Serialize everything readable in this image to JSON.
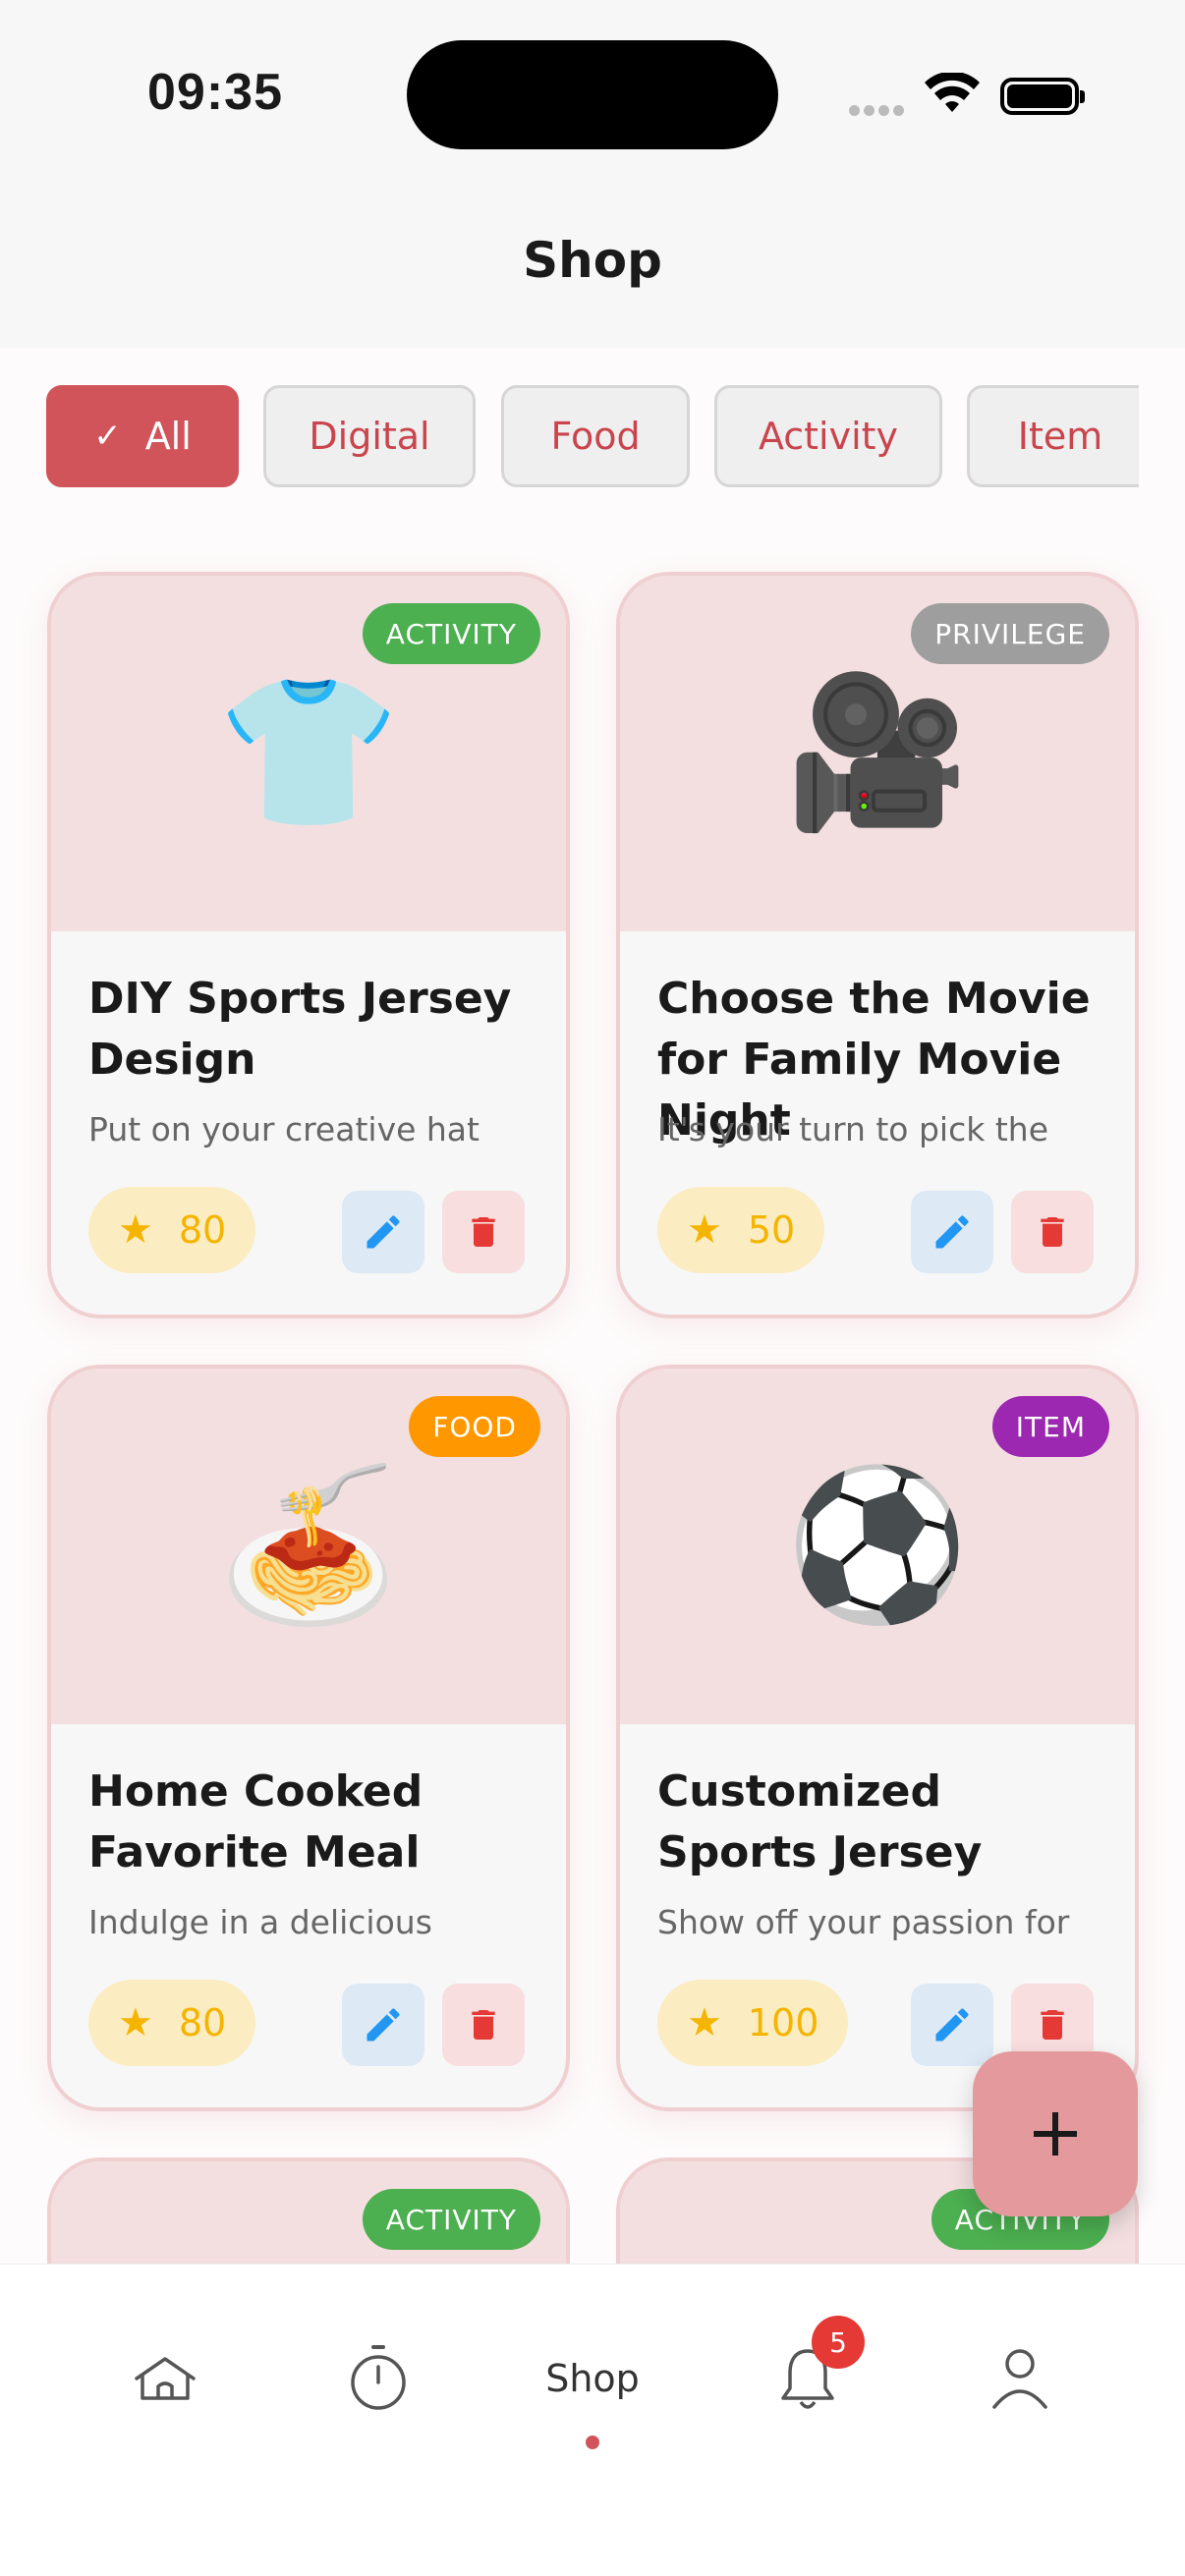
{
  "status_bar": {
    "time": "09:35"
  },
  "header": {
    "title": "Shop"
  },
  "filters": [
    {
      "label": "All",
      "active": true
    },
    {
      "label": "Digital",
      "active": false
    },
    {
      "label": "Food",
      "active": false
    },
    {
      "label": "Activity",
      "active": false
    },
    {
      "label": "Item",
      "active": false
    }
  ],
  "cards": [
    {
      "emoji": "👕",
      "tag": "ACTIVITY",
      "tag_color": "#4caf50",
      "title": "DIY Sports Jersey Design",
      "desc": "Put on your creative hat",
      "points": "80"
    },
    {
      "emoji": "🎥",
      "tag": "PRIVILEGE",
      "tag_color": "#9e9e9e",
      "title": "Choose the Movie for Family Movie Night",
      "desc": "It's your turn to pick the",
      "points": "50"
    },
    {
      "emoji": "🍝",
      "tag": "FOOD",
      "tag_color": "#ff9800",
      "title": "Home Cooked Favorite Meal",
      "desc": "Indulge in a delicious",
      "points": "80"
    },
    {
      "emoji": "⚽",
      "tag": "ITEM",
      "tag_color": "#9c27b0",
      "title": "Customized Sports Jersey",
      "desc": "Show off your passion for",
      "points": "100"
    },
    {
      "tag": "ACTIVITY",
      "tag_color": "#4caf50"
    },
    {
      "tag": "ACTIVITY",
      "tag_color": "#4caf50"
    }
  ],
  "nav": {
    "shop_label": "Shop",
    "notification_count": "5"
  },
  "icons": {
    "edit": "pencil-icon",
    "delete": "trash-icon",
    "points": "star-icon",
    "fab": "plus-icon"
  },
  "colors": {
    "accent": "#d0545a",
    "star": "#f4b400",
    "edit": "#2196f3",
    "delete": "#e53935",
    "fab": "#e49a9c"
  }
}
